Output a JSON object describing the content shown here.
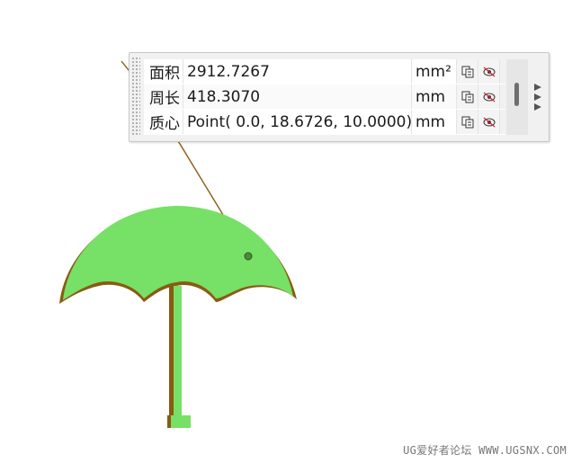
{
  "measure_panel": {
    "rows": [
      {
        "label": "面积",
        "value": "2912.7267",
        "unit": "mm²"
      },
      {
        "label": "周长",
        "value": "418.3070",
        "unit": "mm"
      },
      {
        "label": "质心",
        "value": "Point( 0.0, 18.6726, 10.0000)",
        "unit": "mm"
      }
    ]
  },
  "watermark": "UG爱好者论坛 WWW.UGSNX.COM",
  "colors": {
    "umbrella_fill": "#77e066",
    "umbrella_edge": "#8a5a12",
    "leader_line": "#8a5a12"
  }
}
